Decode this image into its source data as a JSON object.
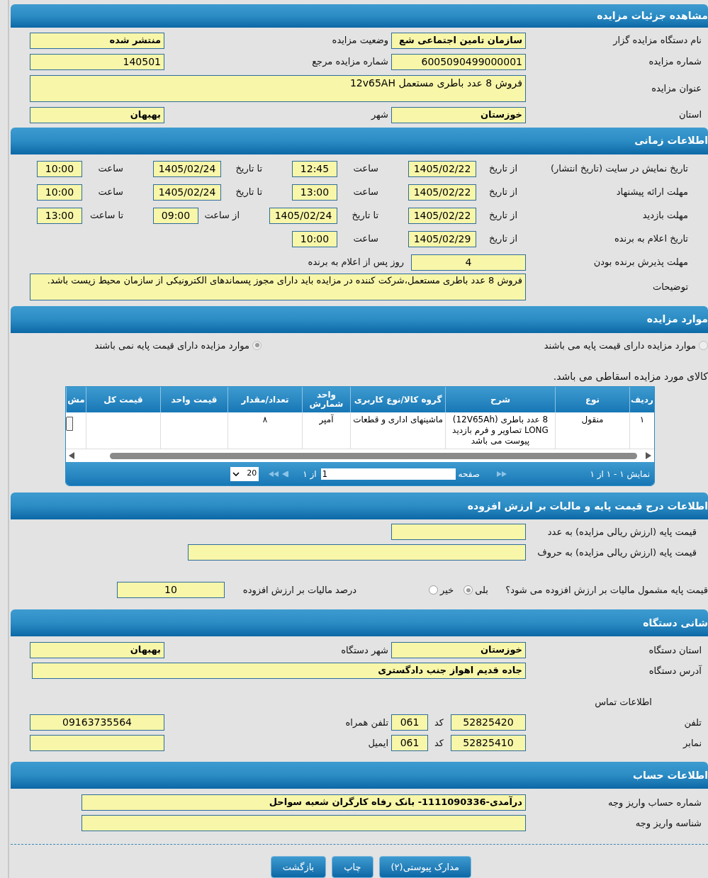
{
  "details": {
    "title": "مشاهده جزئیات مزایده",
    "fields": [
      {
        "label": "نام دستگاه مزایده گزار",
        "value": "سازمان تامین اجتماعی شع"
      },
      {
        "label": "وضعیت مزایده",
        "value": "منتشر شده"
      },
      {
        "label": "شماره مزایده",
        "value": "6005090499000001"
      },
      {
        "label": "شماره مزایده مرجع",
        "value": "140501"
      },
      {
        "label": "عنوان مزایده",
        "value": "فروش 8 عدد باطری مستعمل 12v65AH"
      },
      {
        "label": "استان",
        "value": "خوزستان"
      },
      {
        "label": "شهر",
        "value": "بهبهان"
      }
    ]
  },
  "timing": {
    "title": "اطلاعات زمانی",
    "rows": [
      {
        "label": "تاریخ نمایش در سایت (تاریخ انتشار)",
        "items": [
          {
            "kind": "date",
            "label": "از تاریخ",
            "value": "1405/02/22"
          },
          {
            "kind": "time",
            "label": "ساعت",
            "value": "12:45"
          },
          {
            "kind": "date",
            "label": "تا تاریخ",
            "value": "1405/02/24"
          },
          {
            "kind": "time",
            "label": "ساعت",
            "value": "10:00"
          }
        ]
      },
      {
        "label": "مهلت ارائه پیشنهاد",
        "items": [
          {
            "kind": "date",
            "label": "از تاریخ",
            "value": "1405/02/22"
          },
          {
            "kind": "time",
            "label": "ساعت",
            "value": "13:00"
          },
          {
            "kind": "date",
            "label": "تا تاریخ",
            "value": "1405/02/24"
          },
          {
            "kind": "time",
            "label": "ساعت",
            "value": "10:00"
          }
        ]
      },
      {
        "label": "مهلت بازدید",
        "items": [
          {
            "kind": "date",
            "label": "از تاریخ",
            "value": "1405/02/22"
          },
          {
            "kind": "date",
            "label": "تا تاریخ",
            "value": "1405/02/24"
          },
          {
            "kind": "time",
            "label": "از ساعت",
            "value": "09:00"
          },
          {
            "kind": "time",
            "label": "تا ساعت",
            "value": "13:00"
          }
        ]
      },
      {
        "label": "تاریخ اعلام به برنده",
        "items": [
          {
            "kind": "date",
            "label": "از تاریخ",
            "value": "1405/02/29"
          },
          {
            "kind": "time",
            "label": "ساعت",
            "value": "10:00"
          }
        ]
      },
      {
        "label": "مهلت پذیرش برنده بودن",
        "items": [
          {
            "kind": "number",
            "label": "روز پس از اعلام به برنده",
            "value": "4"
          }
        ]
      }
    ],
    "notes": {
      "label": "توضیحات",
      "value": "فروش 8 عدد باطری مستعمل،شرکت کننده در مزایده باید دارای مجوز پسماندهای الکترونیکی از سازمان محیط زیست باشد."
    }
  },
  "items": {
    "title": "موارد مزایده",
    "options": [
      {
        "label": "موارد مزایده دارای قیمت پایه می باشند",
        "selected": false
      },
      {
        "label": "موارد مزایده دارای قیمت پایه نمی باشند",
        "selected": true
      }
    ],
    "note": "کالای مورد مزایده اسقاطی می باشد.",
    "table": {
      "columns": [
        "ردیف",
        "نوع",
        "شرح",
        "گروه کالا/نوع کاربری",
        "واحد شمارش",
        "تعداد/مقدار",
        "قیمت واحد",
        "قیمت کل",
        "مش"
      ],
      "rows": [
        [
          "۱",
          "منقول",
          "8 عدد باطری (12V65Ah) LONG تصاویر و فرم بازدید پیوست می باشد",
          "ماشینهای اداری و قطعات",
          "آمپر",
          "۸",
          null,
          null
        ]
      ]
    },
    "pager": {
      "summary": "نمایش ۱ - ۱ از ۱",
      "page_label": "صفحه",
      "page": "1",
      "of": "از ۱",
      "page_size": "20"
    }
  },
  "pricing": {
    "title": "اطلاعات درج قیمت پایه و مالیات بر ارزش افزوده",
    "price_number": {
      "label": "قیمت پایه (ارزش ریالی مزایده) به عدد"
    },
    "price_words": {
      "label": "قیمت پایه (ارزش ریالی مزایده) به حروف"
    },
    "vat_question": "قیمت پایه مشمول مالیات بر ارزش افزوده می شود؟",
    "vat_options": [
      {
        "label": "بلی",
        "selected": true
      },
      {
        "label": "خیر",
        "selected": false
      }
    ],
    "vat_percent": {
      "label": "درصد مالیات بر ارزش افزوده",
      "value": "10"
    }
  },
  "address": {
    "title": "شانی دستگاه",
    "province": {
      "label": "استان دستگاه",
      "value": "خوزستان"
    },
    "city": {
      "label": "شهر دستگاه",
      "value": "بهبهان"
    },
    "street": {
      "label": "آدرس دستگاه",
      "value": "جاده قدیم اهواز جنب دادگستری"
    },
    "contact_title": "اطلاعات تماس",
    "phone": {
      "label": "تلفن",
      "value": "52825420",
      "code_label": "کد",
      "code": "061"
    },
    "mobile": {
      "label": "تلفن همراه",
      "value": "09163735564"
    },
    "fax": {
      "label": "نمابر",
      "value": "52825410",
      "code_label": "کد",
      "code": "061"
    },
    "email": {
      "label": "ایمیل"
    }
  },
  "account": {
    "title": "اطلاعات حساب",
    "number": {
      "label": "شماره حساب واریز وجه",
      "value": "درآمدی-1111090336- بانک رفاه کارگران شعبه سواحل"
    },
    "id": {
      "label": "شناسه واریز وجه"
    }
  },
  "buttons": [
    "مدارک پیوستی(۲)",
    "چاپ",
    "بازگشت"
  ]
}
